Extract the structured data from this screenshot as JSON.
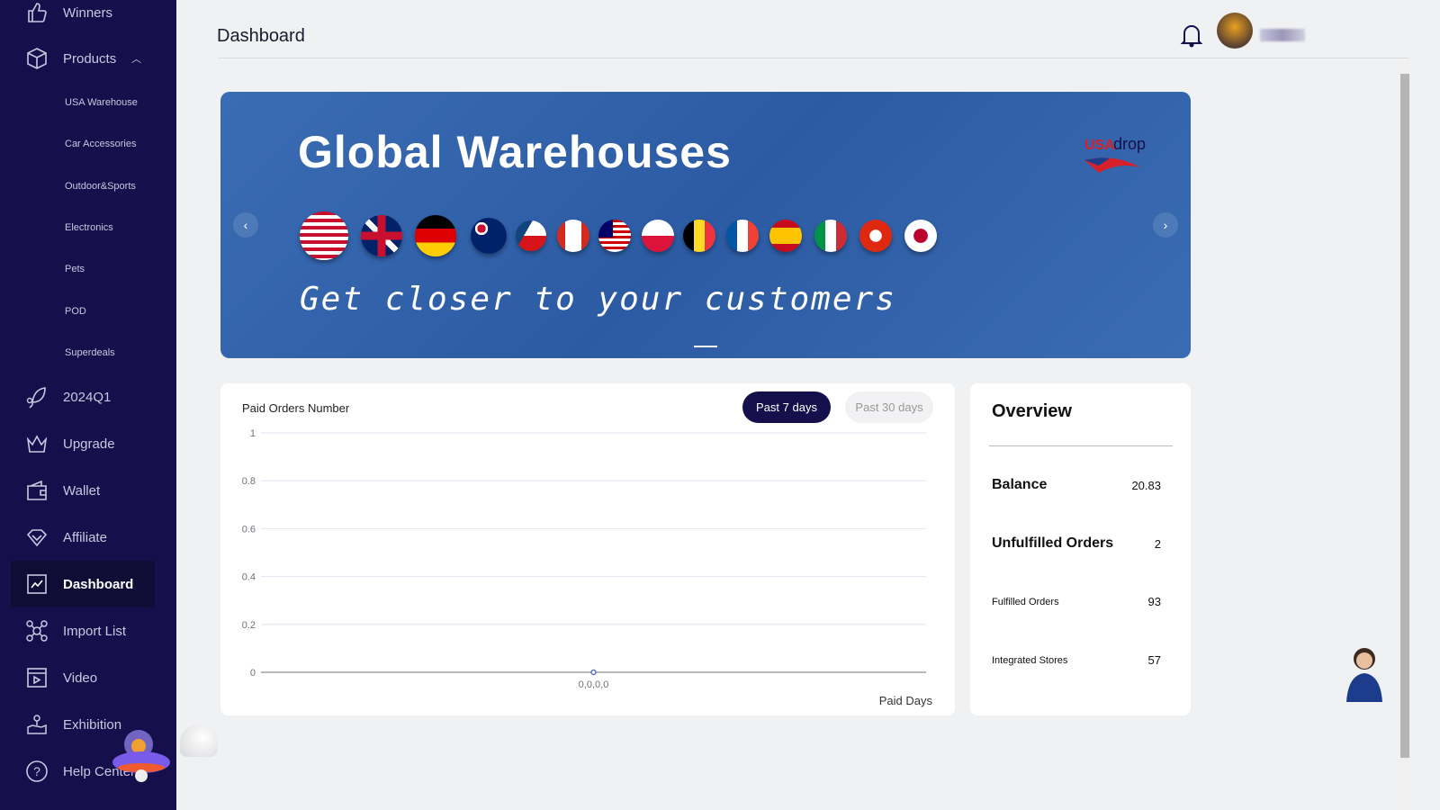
{
  "sidebar": {
    "items": [
      {
        "label": "Winners",
        "icon": "thumbs-up-icon"
      },
      {
        "label": "Products",
        "icon": "box-icon"
      },
      {
        "label": "2024Q1",
        "icon": "leaf-icon"
      },
      {
        "label": "Upgrade",
        "icon": "crown-icon"
      },
      {
        "label": "Wallet",
        "icon": "wallet-icon"
      },
      {
        "label": "Affiliate",
        "icon": "diamond-icon"
      },
      {
        "label": "Dashboard",
        "icon": "chart-icon"
      },
      {
        "label": "Import List",
        "icon": "network-icon"
      },
      {
        "label": "Video",
        "icon": "video-icon"
      },
      {
        "label": "Exhibition",
        "icon": "map-pin-icon"
      },
      {
        "label": "Help Center",
        "icon": "help-icon"
      }
    ],
    "sub_items": [
      "USA Warehouse",
      "Car Accessories",
      "Outdoor&Sports",
      "Electronics",
      "Pets",
      "POD",
      "Superdeals"
    ],
    "active": "Dashboard"
  },
  "header": {
    "title": "Dashboard"
  },
  "banner": {
    "title": "Global Warehouses",
    "subtitle": "Get closer to your customers",
    "logo": "USAdrop",
    "flags": [
      "us",
      "uk",
      "de",
      "au",
      "cz",
      "ca",
      "my",
      "pl",
      "be",
      "fr",
      "es",
      "it",
      "hk",
      "jp"
    ]
  },
  "chart_card": {
    "title": "Paid Orders Number",
    "tab_7": "Past 7 days",
    "tab_30": "Past 30 days",
    "active_tab": "Past 7 days"
  },
  "chart_data": {
    "type": "line",
    "title": "Paid Orders Number",
    "x": [
      "0,0,0,0"
    ],
    "values": [
      0
    ],
    "xlabel": "Paid Days",
    "ylabel": "",
    "ylim": [
      0,
      1
    ],
    "yticks": [
      "0",
      "0.2",
      "0.4",
      "0.6",
      "0.8",
      "1"
    ],
    "grid": true,
    "color": "#5470c6"
  },
  "overview": {
    "title": "Overview",
    "rows": [
      {
        "label": "Balance",
        "value": "20.83"
      },
      {
        "label": "Unfulfilled Orders",
        "value": "2"
      },
      {
        "label": "Fulfilled Orders",
        "value": "93"
      },
      {
        "label": "Integrated Stores",
        "value": "57"
      }
    ]
  },
  "colors": {
    "sidebar": "#15104b",
    "banner": "#2f5fa8",
    "accent": "#15104b"
  }
}
